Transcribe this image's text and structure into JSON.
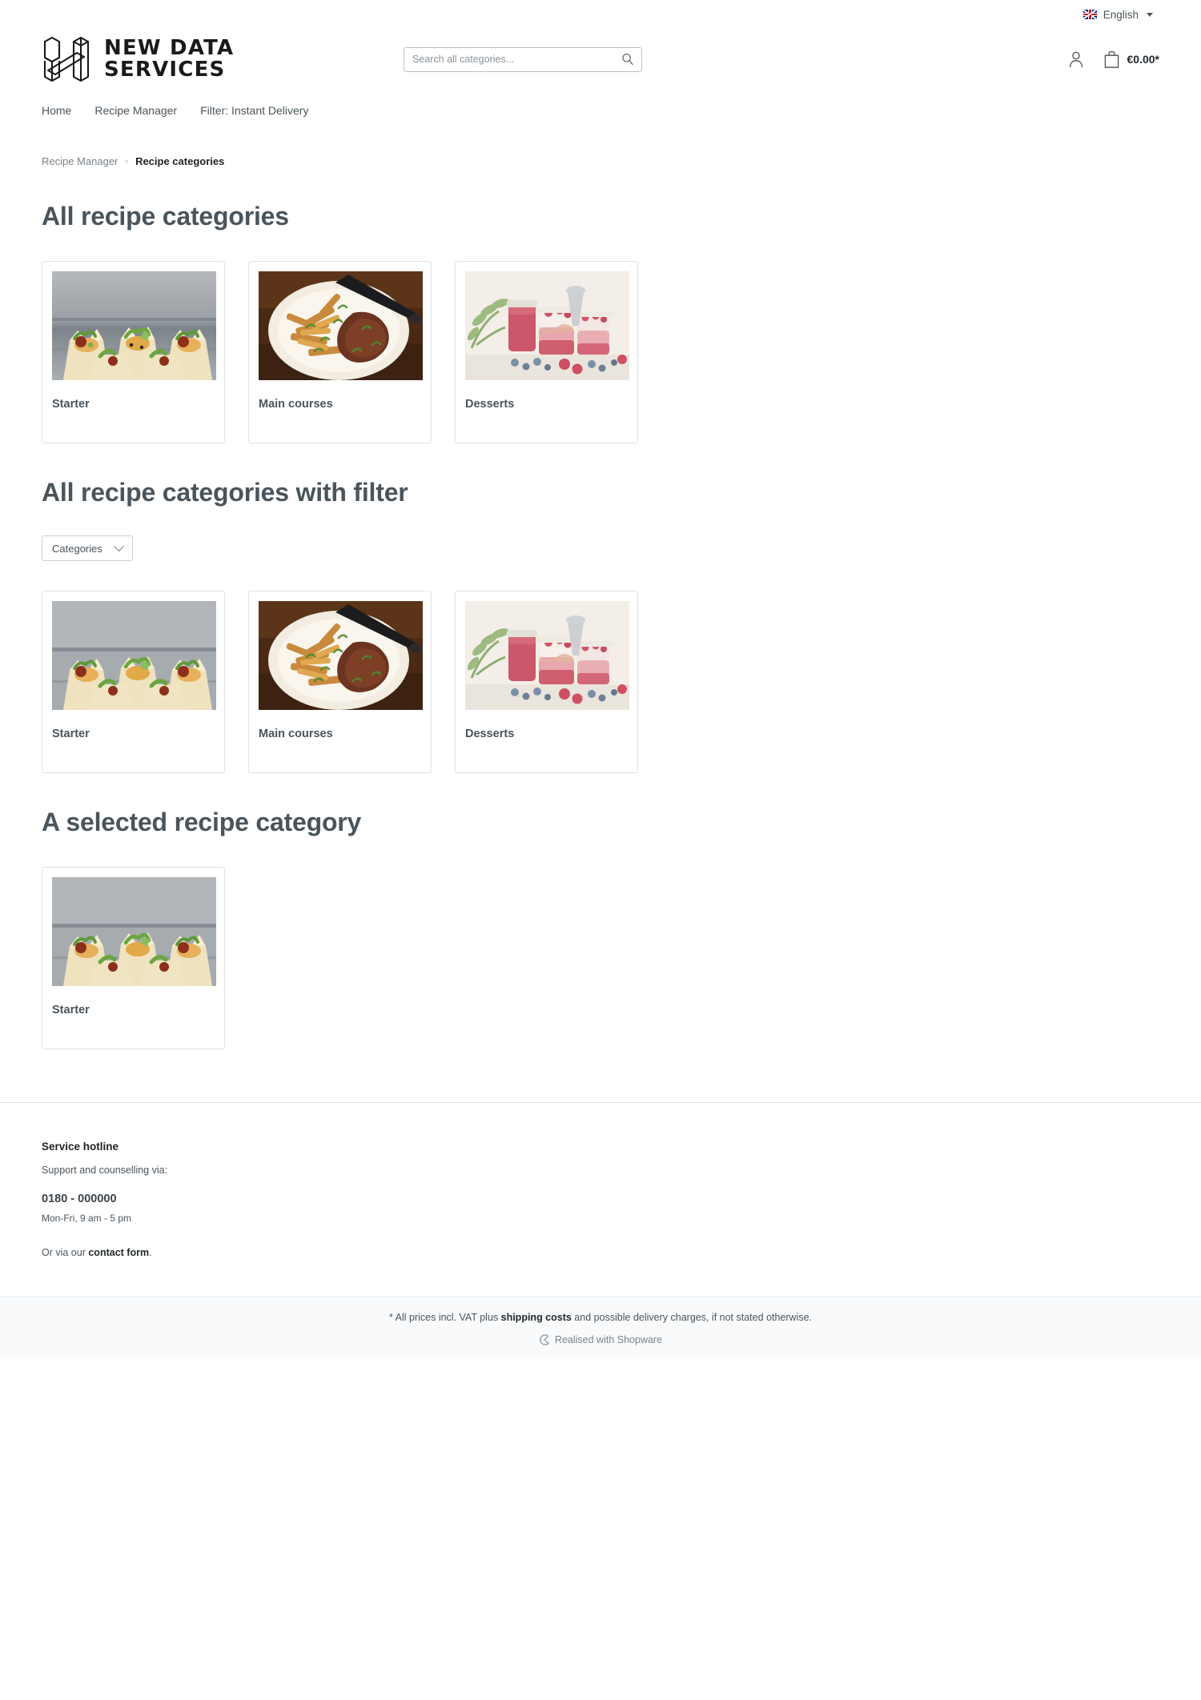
{
  "topbar": {
    "language_label": "English",
    "flag_icon": "uk-flag-icon",
    "caret_icon": "caret-down-icon"
  },
  "header": {
    "logo_text": "NEW DATA\nSERVICES",
    "logo_icon": "isometric-h-logo-icon",
    "search": {
      "placeholder": "Search all categories...",
      "value": "",
      "icon": "search-icon"
    },
    "account_icon": "user-account-icon",
    "cart_icon": "shopping-bag-icon",
    "cart_amount": "€0.00*"
  },
  "nav": {
    "items": [
      {
        "label": "Home"
      },
      {
        "label": "Recipe Manager"
      },
      {
        "label": "Filter: Instant Delivery"
      }
    ]
  },
  "breadcrumb": {
    "parent": "Recipe Manager",
    "separator": "›",
    "current": "Recipe categories"
  },
  "sections": [
    {
      "title": "All recipe categories",
      "has_filter": false,
      "cards": [
        {
          "label": "Starter",
          "image": "starter-appetizer-cups-photo"
        },
        {
          "label": "Main courses",
          "image": "steak-and-fries-plate-photo"
        },
        {
          "label": "Desserts",
          "image": "berry-smoothie-jars-photo"
        }
      ]
    },
    {
      "title": "All recipe categories with filter",
      "has_filter": true,
      "filter_label": "Categories",
      "filter_icon": "chevron-down-icon",
      "cards": [
        {
          "label": "Starter",
          "image": "starter-appetizer-cups-photo"
        },
        {
          "label": "Main courses",
          "image": "steak-and-fries-plate-photo"
        },
        {
          "label": "Desserts",
          "image": "berry-smoothie-jars-photo"
        }
      ]
    },
    {
      "title": "A selected recipe category",
      "has_filter": false,
      "cards": [
        {
          "label": "Starter",
          "image": "starter-appetizer-cups-photo"
        }
      ]
    }
  ],
  "footer": {
    "hotline_title": "Service hotline",
    "support_text": "Support and counselling via:",
    "phone": "0180 - 000000",
    "hours": "Mon-Fri, 9 am - 5 pm",
    "contact_prefix": "Or via our ",
    "contact_link": "contact form",
    "contact_suffix": "."
  },
  "bottom": {
    "vat_prefix": "* All prices incl. VAT plus ",
    "vat_link": "shipping costs",
    "vat_suffix": " and possible delivery charges, if not stated otherwise.",
    "realised_text": "Realised with Shopware",
    "realised_icon": "shopware-logo-icon"
  },
  "colors": {
    "heading": "#4a545b",
    "text": "#4a545b",
    "muted": "#798188",
    "border": "#dfe3e8",
    "dark": "#1f2326",
    "bottom_bg": "#f9fafb"
  }
}
